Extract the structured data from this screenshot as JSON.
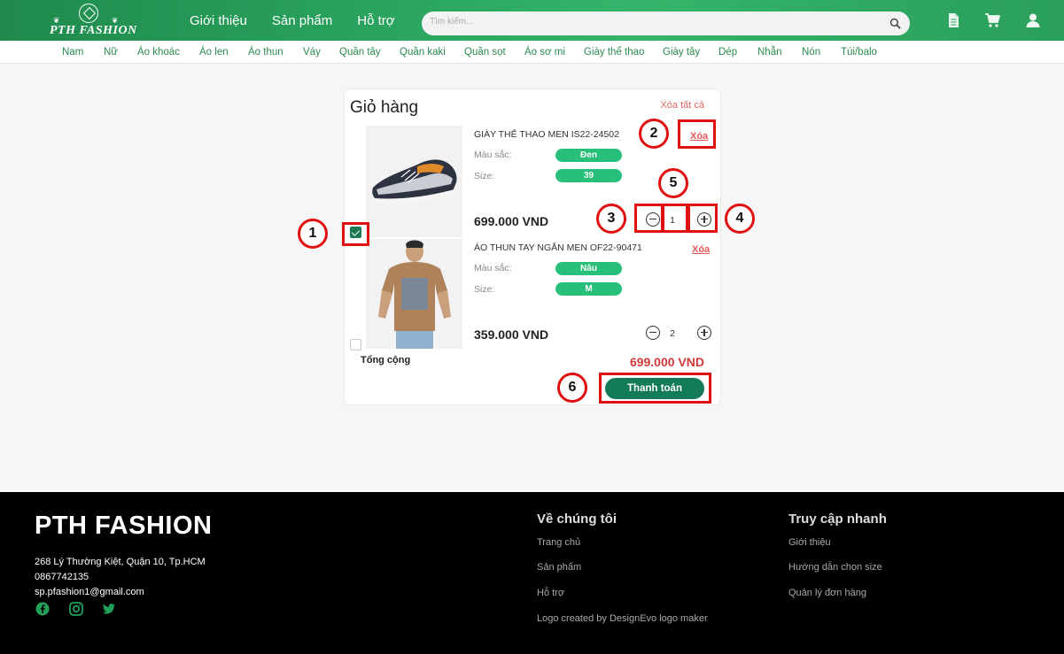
{
  "header": {
    "brand": "PTH FASHION",
    "nav": [
      "Giới thiệu",
      "Sản phẩm",
      "Hỗ trợ"
    ],
    "search_placeholder": "Tìm kiếm...",
    "accent": "#2aa35e"
  },
  "categories": [
    "Nam",
    "Nữ",
    "Áo khoác",
    "Áo len",
    "Áo thun",
    "Váy",
    "Quần tây",
    "Quần kaki",
    "Quần sọt",
    "Áo sơ mi",
    "Giày thể thao",
    "Giày tây",
    "Dép",
    "Nhẫn",
    "Nón",
    "Túi/balo"
  ],
  "cart": {
    "title": "Giỏ hàng",
    "clear_all": "Xóa tất cả",
    "color_label": "Màu sắc:",
    "size_label": "Size:",
    "delete_label": "Xóa",
    "items": [
      {
        "name": "GIÀY THỂ THAO MEN IS22-24502",
        "color": "Đen",
        "size": "39",
        "price": "699.000 VND",
        "qty": "1",
        "checked": true
      },
      {
        "name": "ÁO THUN TAY NGẮN MEN OF22-90471",
        "color": "Nâu",
        "size": "M",
        "price": "359.000 VND",
        "qty": "2",
        "checked": false
      }
    ],
    "total_label": "Tổng cộng",
    "total_value": "699.000 VND",
    "checkout": "Thanh toán"
  },
  "annotations": [
    "1",
    "2",
    "3",
    "4",
    "5",
    "6"
  ],
  "footer": {
    "brand": "PTH FASHION",
    "address": "268 Lý Thường Kiệt, Quận 10, Tp.HCM",
    "phone": "0867742135",
    "email": "sp.pfashion1@gmail.com",
    "about_title": "Về chúng tôi",
    "about_links": [
      "Trang chủ",
      "Sản phẩm",
      "Hỗ trợ",
      "Logo created by DesignEvo logo maker"
    ],
    "quick_title": "Truy cập nhanh",
    "quick_links": [
      "Giới thiệu",
      "Hướng dẫn chọn size",
      "Quản lý đơn hàng"
    ]
  }
}
